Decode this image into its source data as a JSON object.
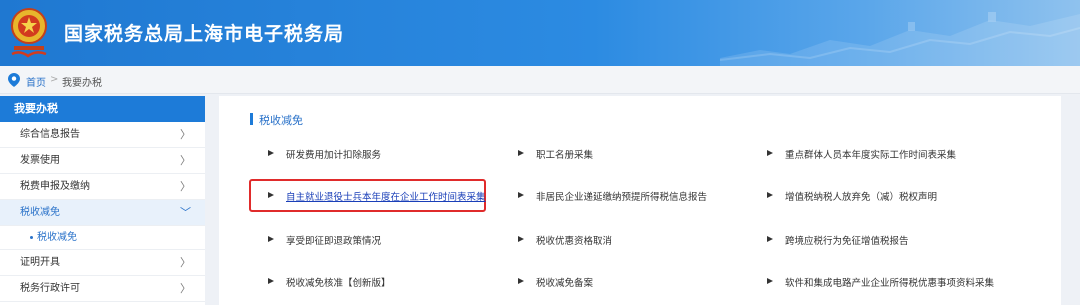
{
  "header": {
    "title": "国家税务总局上海市电子税务局",
    "emblem_icon": "tax-emblem-icon"
  },
  "breadcrumb": {
    "home": "首页",
    "separator": ">",
    "current": "我要办税"
  },
  "sidebar": {
    "heading": "我要办税",
    "items": [
      {
        "label": "综合信息报告",
        "arrow": "〉"
      },
      {
        "label": "发票使用",
        "arrow": "〉"
      },
      {
        "label": "税费申报及缴纳",
        "arrow": "〉"
      },
      {
        "label": "税收减免",
        "arrow": "﹀"
      },
      {
        "label": "税收减免"
      },
      {
        "label": "证明开具",
        "arrow": "〉"
      },
      {
        "label": "税务行政许可",
        "arrow": "〉"
      }
    ]
  },
  "main": {
    "section_title": "税收减免",
    "items": [
      "研发费用加计扣除服务",
      "职工名册采集",
      "重点群体人员本年度实际工作时间表采集",
      "自主就业退役士兵本年度在企业工作时间表采集",
      "非居民企业递延缴纳预提所得税信息报告",
      "增值税纳税人放弃免（减）税权声明",
      "享受即征即退政策情况",
      "税收优惠资格取消",
      "跨境应税行为免征增值税报告",
      "税收减免核准【创新版】",
      "税收减免备案",
      "软件和集成电路产业企业所得税优惠事项资料采集"
    ]
  },
  "colors": {
    "header_blue": "#1f78d1",
    "accent_blue": "#1d7bd8",
    "highlight_red": "#e02b2b",
    "link_blue": "#1a3fb8"
  }
}
